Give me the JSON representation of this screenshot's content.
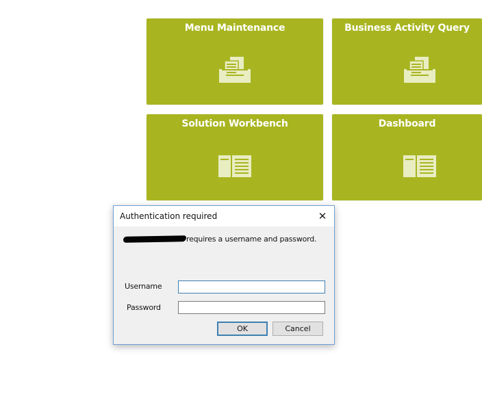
{
  "tiles": [
    {
      "title": "Menu Maintenance",
      "icon": "documents-tray-icon"
    },
    {
      "title": "Business Activity Query",
      "icon": "documents-tray-icon"
    },
    {
      "title": "Solution Workbench",
      "icon": "open-book-icon"
    },
    {
      "title": "Dashboard",
      "icon": "open-book-icon"
    }
  ],
  "dialog": {
    "title": "Authentication required",
    "close_glyph": "✕",
    "message": "requires a username and password.",
    "username_label": "Username",
    "password_label": "Password",
    "username_value": "",
    "password_value": "",
    "ok_label": "OK",
    "cancel_label": "Cancel"
  },
  "colors": {
    "tile_bg": "#a8b520",
    "icon_fill": "#e9edc2",
    "focus_border": "#3c7fb1"
  }
}
